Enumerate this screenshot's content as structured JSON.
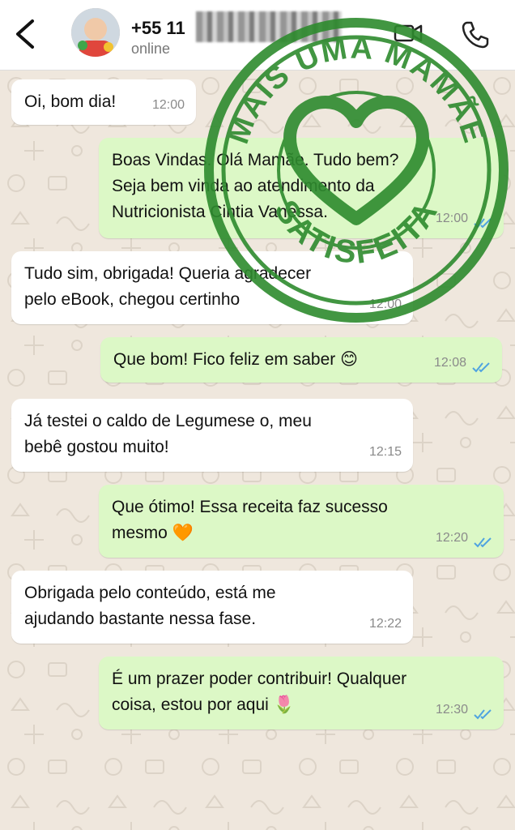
{
  "header": {
    "contact_name": "+55 11",
    "status": "online"
  },
  "messages": [
    {
      "id": "m1",
      "direction": "in",
      "text_lines": [
        "Oi, bom dia!"
      ],
      "time": "12:00"
    },
    {
      "id": "m2",
      "direction": "out",
      "text_lines": [
        "Boas Vindas. Olá Mamãe. Tudo bem?",
        "Seja bem vinda ao atendimento da",
        "Nutricionista Cintia Vanessa."
      ],
      "time": "12:00"
    },
    {
      "id": "m3",
      "direction": "in",
      "text_lines": [
        "Tudo sim, obrigada! Queria agradecer",
        "pelo eBook, chegou certinho"
      ],
      "time": "12:00"
    },
    {
      "id": "m4",
      "direction": "out",
      "text_lines": [
        "Que bom! Fico feliz em saber 😊"
      ],
      "time": "12:08"
    },
    {
      "id": "m5",
      "direction": "in",
      "text_lines": [
        "Já testei o caldo de Legumese o, meu",
        "bebê gostou muito!"
      ],
      "time": "12:15"
    },
    {
      "id": "m6",
      "direction": "out",
      "text_lines": [
        "Que ótimo! Essa receita faz sucesso",
        "mesmo 🧡"
      ],
      "time": "12:20"
    },
    {
      "id": "m7",
      "direction": "in",
      "text_lines": [
        "Obrigada pelo conteúdo, está me",
        "ajudando bastante nessa fase."
      ],
      "time": "12:22"
    },
    {
      "id": "m8",
      "direction": "out",
      "text_lines": [
        "É um prazer poder contribuir! Qualquer",
        "coisa, estou por aqui 🌷"
      ],
      "time": "12:30"
    }
  ],
  "stamp": {
    "top_text": "MAIS UMA MAMÃE",
    "bottom_text": "SATISFEITA",
    "icon": "heart-icon",
    "color": "#2e8b2e"
  },
  "colors": {
    "chat_bg": "#efe7dd",
    "incoming_bubble": "#ffffff",
    "outgoing_bubble": "#dcf8c6",
    "read_ticks": "#4fa3e0"
  },
  "icons": [
    "back-arrow-icon",
    "video-call-icon",
    "phone-icon",
    "double-check-icon"
  ]
}
